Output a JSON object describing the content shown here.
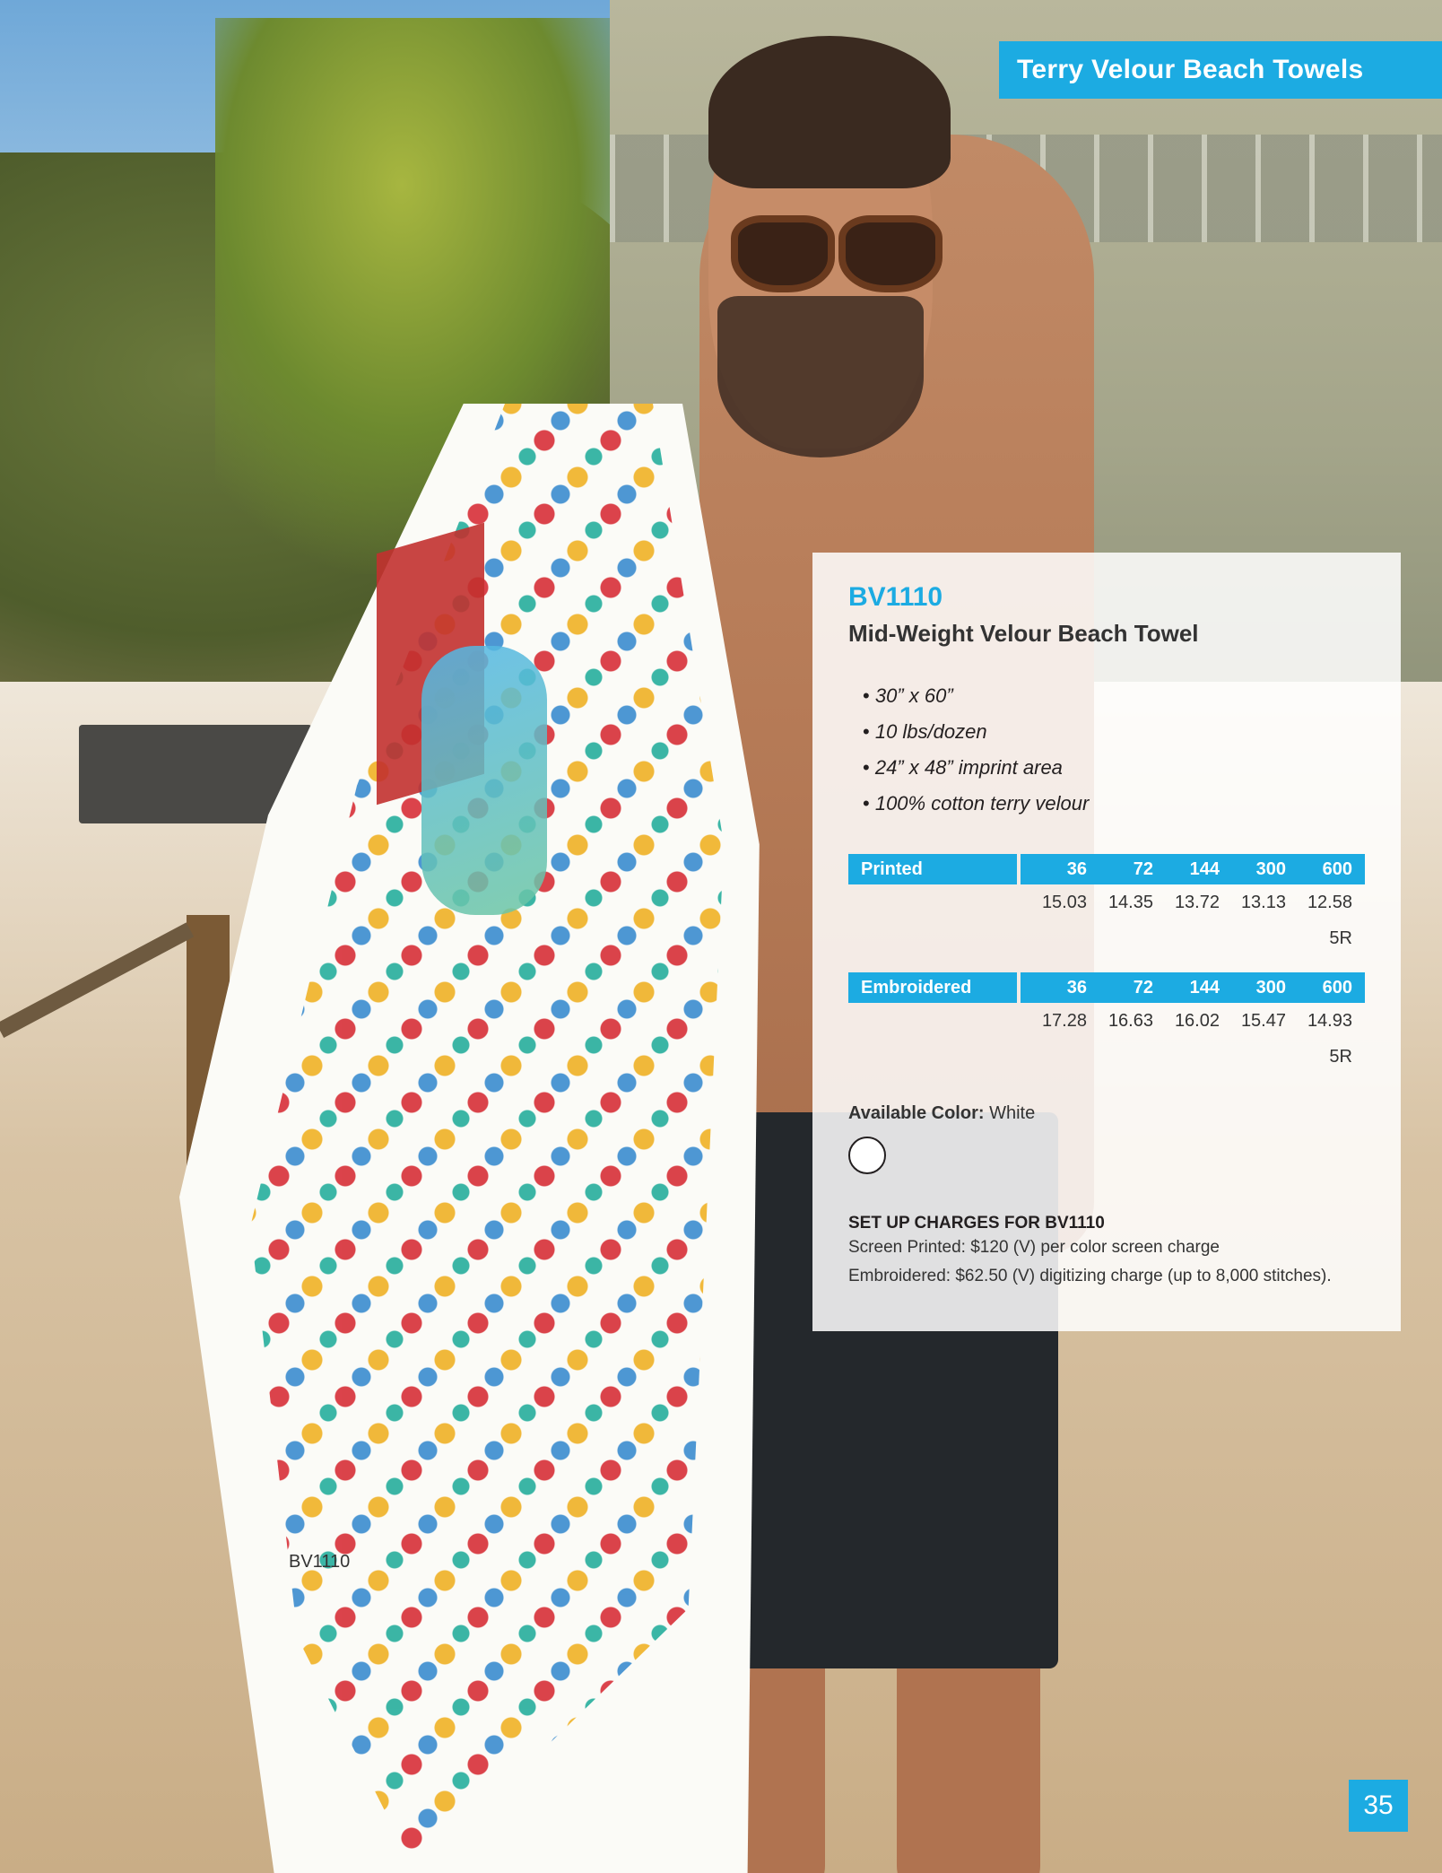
{
  "header": {
    "title": "Terry Velour Beach Towels"
  },
  "product": {
    "sku": "BV1110",
    "name": "Mid-Weight Velour Beach Towel",
    "specs": [
      "30” x 60”",
      "10 lbs/dozen",
      "24” x 48” imprint area",
      "100% cotton terry velour"
    ]
  },
  "pricing": {
    "printed": {
      "label": "Printed",
      "quantities": [
        "36",
        "72",
        "144",
        "300",
        "600"
      ],
      "prices": [
        "15.03",
        "14.35",
        "13.72",
        "13.13",
        "12.58"
      ],
      "code": "5R"
    },
    "embroidered": {
      "label": "Embroidered",
      "quantities": [
        "36",
        "72",
        "144",
        "300",
        "600"
      ],
      "prices": [
        "17.28",
        "16.63",
        "16.02",
        "15.47",
        "14.93"
      ],
      "code": "5R"
    }
  },
  "colors": {
    "label": "Available Color:",
    "value": "White",
    "swatch": "#ffffff"
  },
  "setup": {
    "title": "SET UP CHARGES FOR BV1110",
    "lines": [
      "Screen Printed: $120 (V) per color screen charge",
      "Embroidered: $62.50 (V) digitizing charge (up to 8,000 stitches)."
    ]
  },
  "photo_caption": "BV1110",
  "page_number": "35",
  "accent_color": "#1cabe2"
}
